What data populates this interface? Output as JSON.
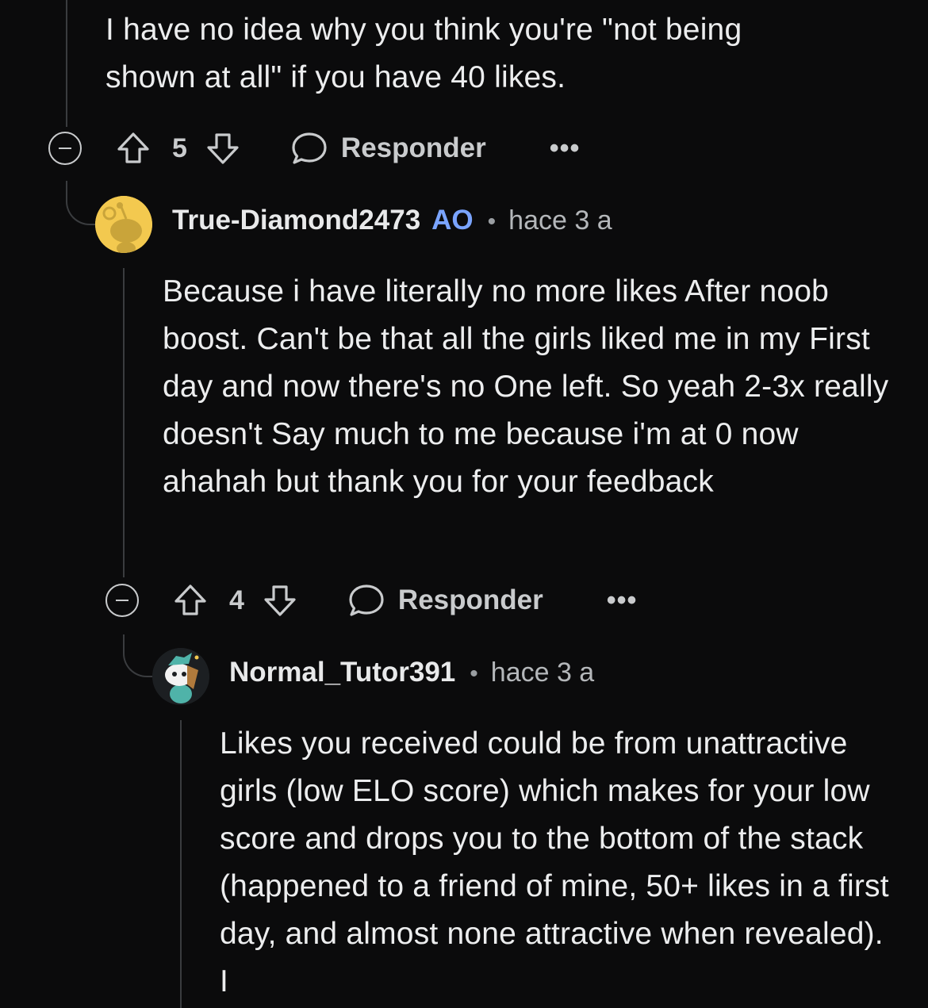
{
  "comment1": {
    "text": "I have no idea why you think you're \"not being shown at all\" if you have 40 likes.",
    "votes": "5",
    "reply_label": "Responder",
    "more": "•••"
  },
  "comment2": {
    "author": "True-Diamond2473",
    "op_badge": "AO",
    "separator": "•",
    "time": "hace 3 a",
    "text": "Because i have literally no more likes After noob boost. Can't be that all the girls liked me in my First day and now there's no One left. So yeah 2-3x really doesn't Say much to me because i'm at 0 now ahahah but thank you for your feedback",
    "votes": "4",
    "reply_label": "Responder",
    "more": "•••"
  },
  "comment3": {
    "author": "Normal_Tutor391",
    "separator": "•",
    "time": "hace 3 a",
    "text": "Likes you received could be from unattractive girls (low ELO score) which makes for your low score and drops you to the bottom of the stack (happened to a friend of mine, 50+ likes in a first day, and almost none attractive when revealed). I"
  },
  "icons": [
    "collapse-icon",
    "upvote-icon",
    "downvote-icon",
    "comment-bubble-icon",
    "more-icon"
  ],
  "colors": {
    "background": "#0b0b0c",
    "op_badge": "#7aa4ff",
    "text": "#ecedee",
    "muted": "#c9cbcd"
  }
}
